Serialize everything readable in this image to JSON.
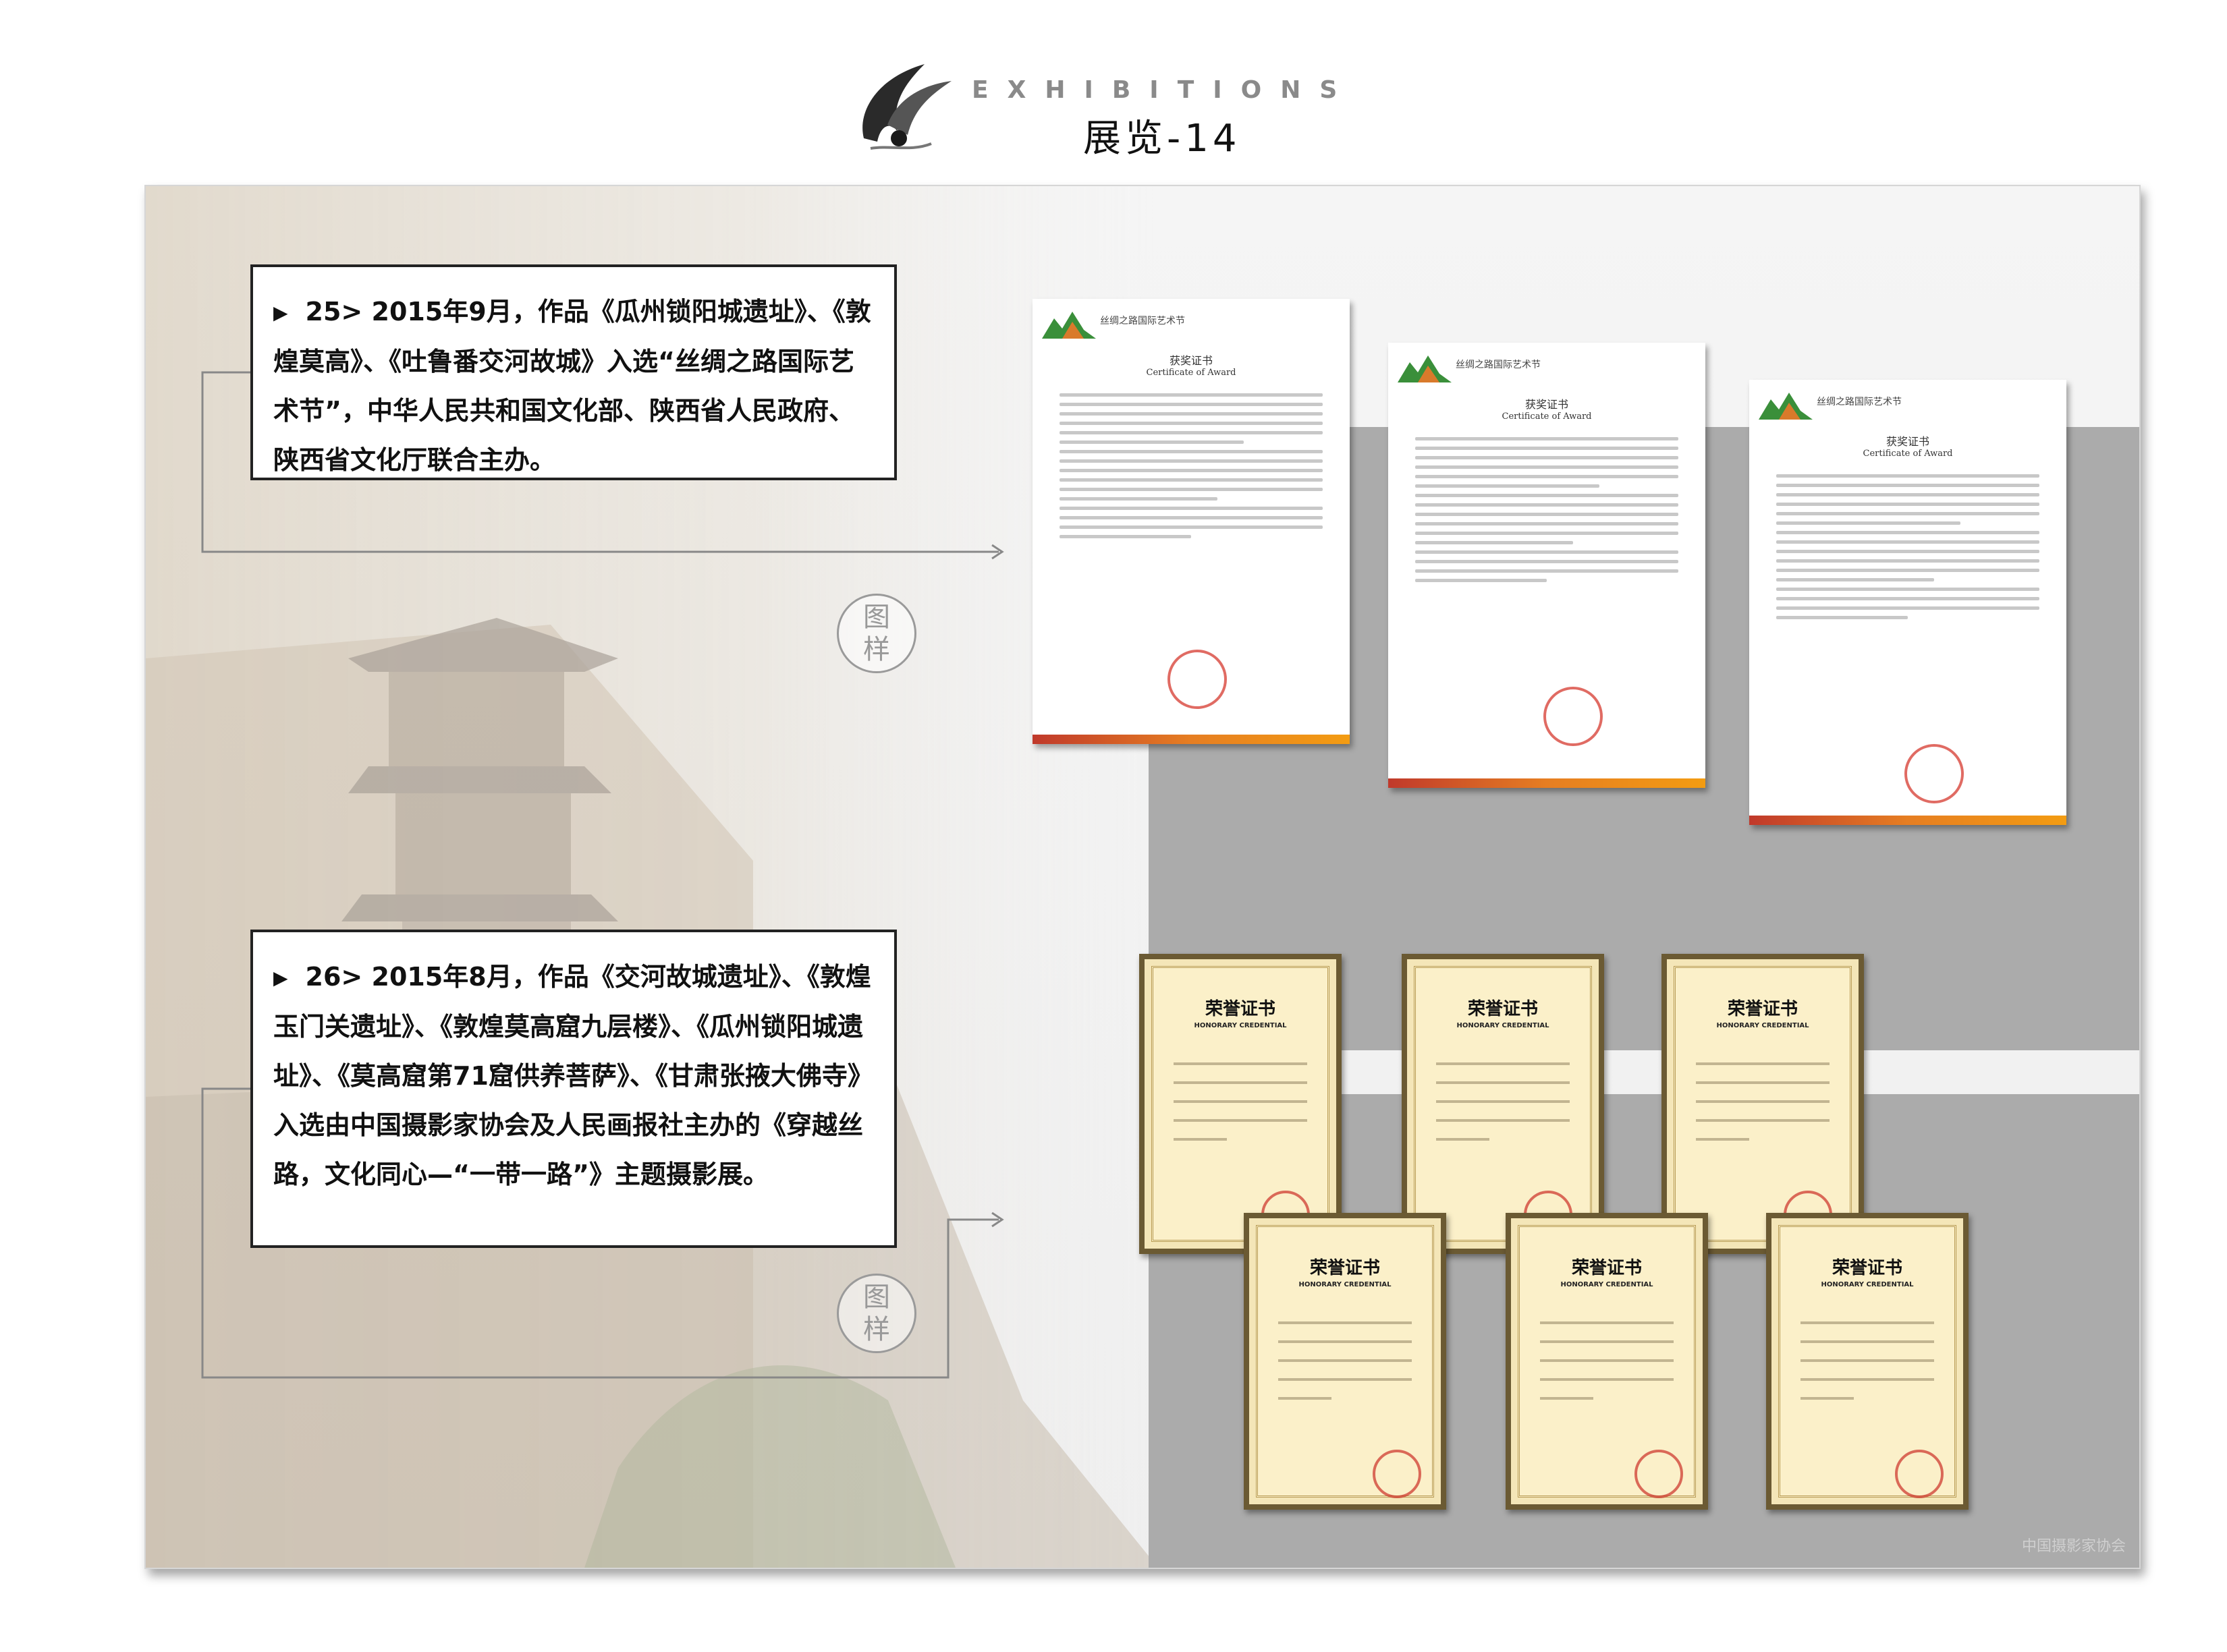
{
  "header": {
    "kicker": "EXHIBITIONS",
    "title": "展览-14"
  },
  "entries": [
    {
      "marker": "▶",
      "text": "25> 2015年9月，作品《瓜州锁阳城遗址》、《敦煌莫高》、《吐鲁番交河故城》入选“丝绸之路国际艺术节”，中华人民共和国文化部、陕西省人民政府、陕西省文化厅联合主办。"
    },
    {
      "marker": "▶",
      "text": "26> 2015年8月，作品《交河故城遗址》、《敦煌玉门关遗址》、《敦煌莫高窟九层楼》、《瓜州锁阳城遗址》、《莫高窟第71窟供养菩萨》、《甘肃张掖大佛寺》入选由中国摄影家协会及人民画报社主办的《穿越丝路，文化同心—“一带一路”》主题摄影展。"
    }
  ],
  "badge": {
    "line1": "图",
    "line2": "样"
  },
  "award_certificates": [
    {
      "head": "丝绸之路国际艺术节",
      "title": "获奖证书",
      "subtitle": "Certificate of Award"
    },
    {
      "head": "丝绸之路国际艺术节",
      "title": "获奖证书",
      "subtitle": "Certificate of Award"
    },
    {
      "head": "丝绸之路国际艺术节",
      "title": "获奖证书",
      "subtitle": "Certificate of Award"
    }
  ],
  "honorary_certificates": [
    {
      "title": "荣誉证书",
      "subtitle": "HONORARY CREDENTIAL"
    },
    {
      "title": "荣誉证书",
      "subtitle": "HONORARY CREDENTIAL"
    },
    {
      "title": "荣誉证书",
      "subtitle": "HONORARY CREDENTIAL"
    },
    {
      "title": "荣誉证书",
      "subtitle": "HONORARY CREDENTIAL"
    },
    {
      "title": "荣誉证书",
      "subtitle": "HONORARY CREDENTIAL"
    },
    {
      "title": "荣誉证书",
      "subtitle": "HONORARY CREDENTIAL"
    }
  ],
  "colors": {
    "frame_gray": "#ababab",
    "seal_red": "#d53a2f",
    "honor_paper": "#fbf0c9"
  }
}
